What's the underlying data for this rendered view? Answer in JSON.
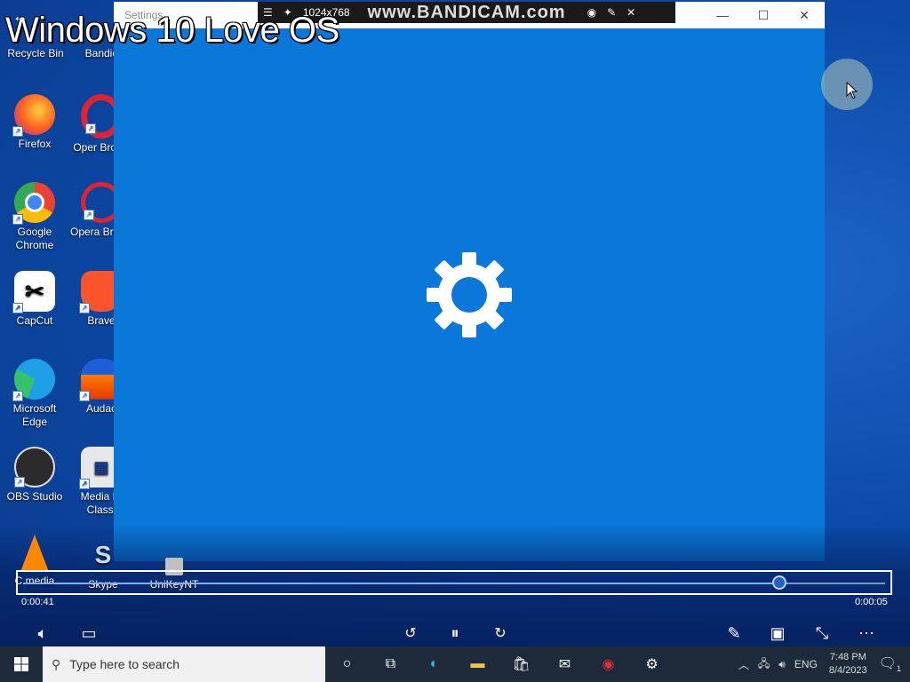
{
  "overlay": {
    "watermark": "Windows 10 Love OS",
    "bandicam_resolution": "1024x768",
    "bandicam_brand": "www.BANDICAM.com"
  },
  "desktop_icons": [
    {
      "label": "Recycle Bin",
      "icon": "recycle-bin-icon"
    },
    {
      "label": "Bandic",
      "icon": "bandicam-icon"
    },
    {
      "label": "Firefox",
      "icon": "firefox-icon"
    },
    {
      "label": "Oper Brows",
      "icon": "opera-icon"
    },
    {
      "label": "Google Chrome",
      "icon": "chrome-icon"
    },
    {
      "label": "Opera Brows",
      "icon": "opera-gx-icon"
    },
    {
      "label": "CapCut",
      "icon": "capcut-icon"
    },
    {
      "label": "Brave",
      "icon": "brave-icon"
    },
    {
      "label": "Microsoft Edge",
      "icon": "edge-icon"
    },
    {
      "label": "Audac",
      "icon": "audacity-icon"
    },
    {
      "label": "OBS Studio",
      "icon": "obs-icon"
    },
    {
      "label": "Media Pl Classi",
      "icon": "media-player-classic-icon"
    },
    {
      "label": "C media",
      "icon": "vlc-icon"
    },
    {
      "label": "Skype",
      "icon": "skype-icon"
    },
    {
      "label": "UniKeyNT",
      "icon": "unikey-icon"
    }
  ],
  "settings_window": {
    "title": "Settings"
  },
  "player": {
    "current_time": "0:00:41",
    "remaining_time": "0:00:05",
    "progress": 0.878
  },
  "taskbar": {
    "search_placeholder": "Type here to search",
    "language": "ENG",
    "time": "7:48 PM",
    "date": "8/4/2023",
    "notification_count": "1"
  },
  "colors": {
    "settings_blue": "#0a78d8",
    "taskbar": "#1c2a3a"
  }
}
